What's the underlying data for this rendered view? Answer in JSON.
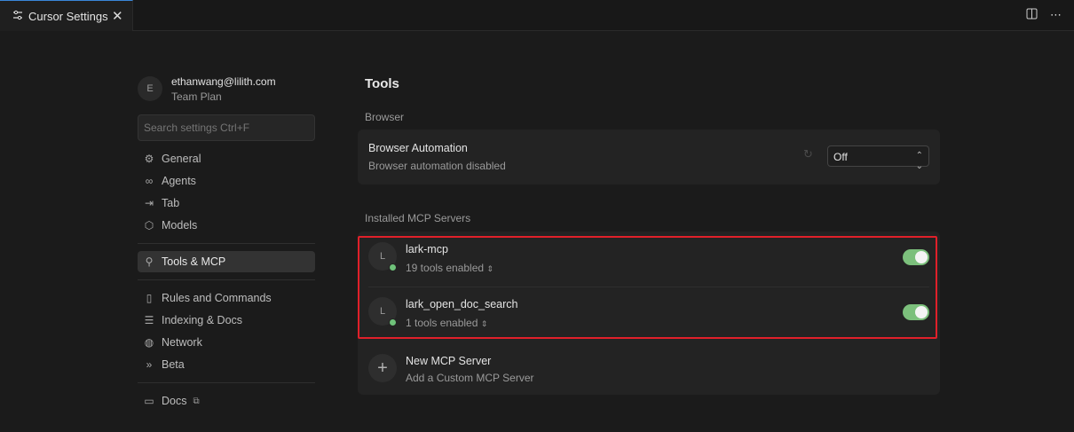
{
  "tab": {
    "title": "Cursor Settings",
    "close": "✕"
  },
  "account": {
    "initial": "E",
    "email": "ethanwang@lilith.com",
    "plan": "Team Plan"
  },
  "search": {
    "placeholder": "Search settings Ctrl+F"
  },
  "nav": {
    "group1": [
      {
        "label": "General",
        "icon": "gear-icon"
      },
      {
        "label": "Agents",
        "icon": "infinity-icon"
      },
      {
        "label": "Tab",
        "icon": "tab-arrow-icon"
      },
      {
        "label": "Models",
        "icon": "cube-icon"
      }
    ],
    "group2": [
      {
        "label": "Tools & MCP",
        "icon": "tools-icon",
        "active": true
      }
    ],
    "group3": [
      {
        "label": "Rules and Commands",
        "icon": "document-icon"
      },
      {
        "label": "Indexing & Docs",
        "icon": "database-icon"
      },
      {
        "label": "Network",
        "icon": "globe-icon"
      },
      {
        "label": "Beta",
        "icon": "chevrons-right-icon"
      }
    ],
    "group4": [
      {
        "label": "Docs",
        "icon": "book-icon"
      }
    ]
  },
  "main": {
    "title": "Tools",
    "browser_section": "Browser",
    "browser_card": {
      "title": "Browser Automation",
      "subtitle": "Browser automation disabled",
      "select_value": "Off"
    },
    "mcp_section": "Installed MCP Servers",
    "servers": [
      {
        "initial": "L",
        "name": "lark-mcp",
        "tools": "19 tools enabled",
        "enabled": true,
        "status": "connected"
      },
      {
        "initial": "L",
        "name": "lark_open_doc_search",
        "tools": "1 tools enabled",
        "enabled": true,
        "status": "connected"
      }
    ],
    "new_server": {
      "title": "New MCP Server",
      "subtitle": "Add a Custom MCP Server"
    }
  },
  "colors": {
    "accent_green": "#7cc07c",
    "highlight_red": "#e0202a",
    "tab_accent": "#3a86d9"
  }
}
